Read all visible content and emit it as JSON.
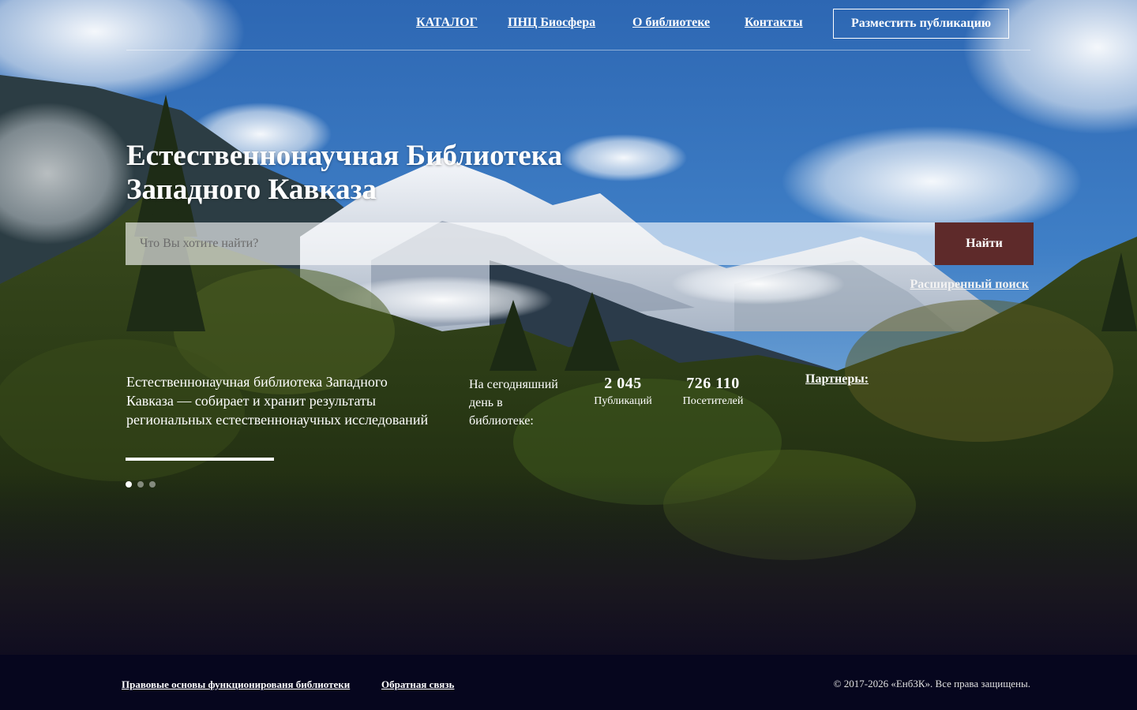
{
  "nav": {
    "items": [
      {
        "label": "КАТАЛОГ"
      },
      {
        "label": "ПНЦ Биосфера"
      },
      {
        "label": "О библиотеке"
      },
      {
        "label": "Контакты"
      }
    ],
    "cta_label": "Разместить публикацию"
  },
  "hero": {
    "title_line1": "Естественнонаучная Библиотека",
    "title_line2": "Западного Кавказа"
  },
  "search": {
    "placeholder": "Что Вы хотите найти?",
    "value": "",
    "button_label": "Найти",
    "advanced_label": "Расширенный поиск"
  },
  "info": {
    "description": "Естественнонаучная библиотека Западного Кавказа — собирает и хранит результаты региональных естественнонаучных исследований",
    "slider_dots": 3,
    "slider_active": 1,
    "today_label": "На сегодняшний день в библиотеке:",
    "stats": [
      {
        "value": "2 045",
        "label": "Публикаций"
      },
      {
        "value": "726 110",
        "label": "Посетителей"
      }
    ],
    "partners_label": "Партнеры:"
  },
  "footer": {
    "links": [
      {
        "label": "Правовые основы функционированя библиотеки"
      },
      {
        "label": "Обратная связь"
      }
    ],
    "copyright": "© 2017-2026 «ЕнбЗК». Все права защищены."
  },
  "colors": {
    "search_button": "#5e2a2a",
    "sky_top": "#2f6bb5",
    "footer_bg": "#0a0a24"
  }
}
